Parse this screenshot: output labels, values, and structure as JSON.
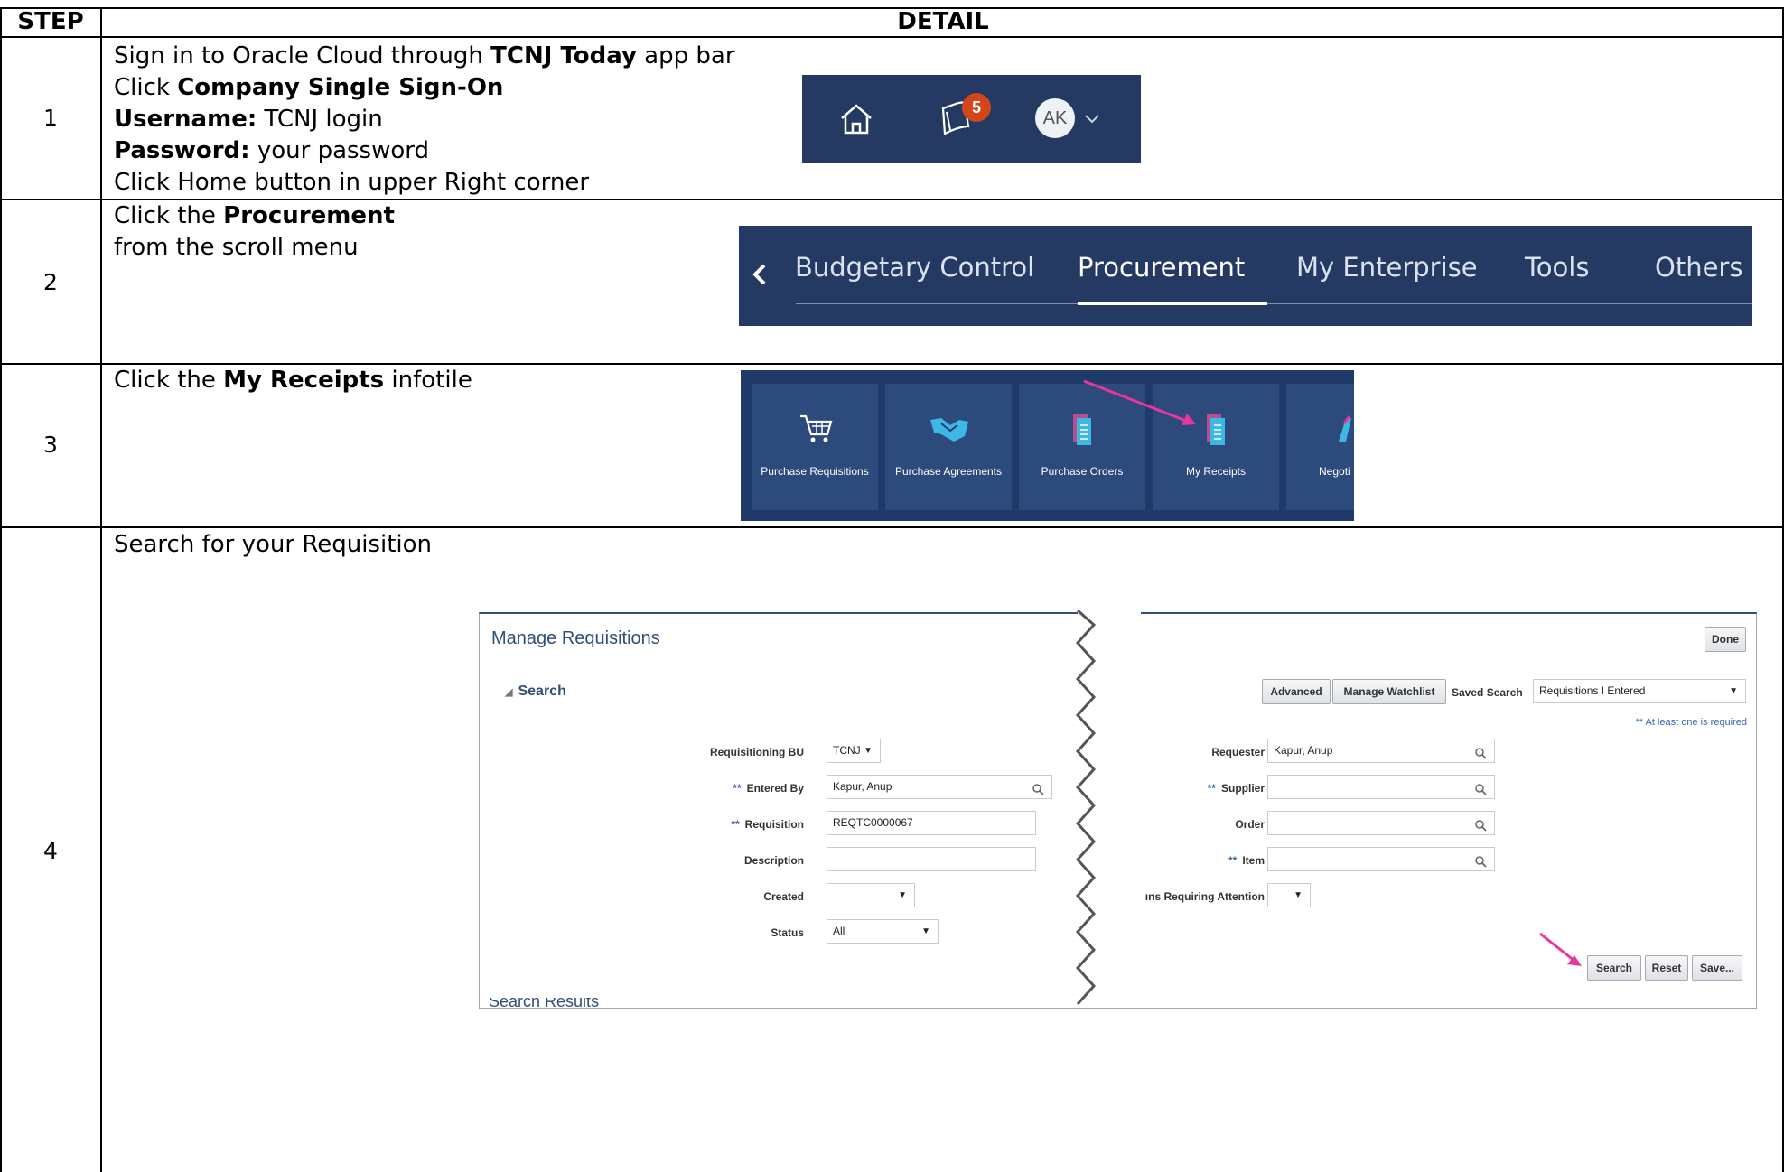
{
  "table": {
    "headers": {
      "step": "STEP",
      "detail": "DETAIL"
    },
    "rows": [
      {
        "step": "1"
      },
      {
        "step": "2"
      },
      {
        "step": "3"
      },
      {
        "step": "4"
      }
    ]
  },
  "step1": {
    "l1_a": "Sign in to Oracle Cloud through ",
    "l1_b": "TCNJ Today",
    "l1_c": " app bar",
    "l2_a": "Click ",
    "l2_b": "Company Single Sign-On",
    "l3_a": "Username:",
    "l3_b": " TCNJ login",
    "l4_a": "Password:",
    "l4_b": " your password",
    "l5": "Click Home button in upper Right corner",
    "appbar": {
      "badge": "5",
      "avatar": "AK"
    }
  },
  "step2": {
    "l1_a": "Click the ",
    "l1_b": "Procurement",
    "l2": "from the scroll menu",
    "nav": [
      "Budgetary Control",
      "Procurement",
      "My Enterprise",
      "Tools",
      "Others"
    ]
  },
  "step3": {
    "l1_a": "Click the ",
    "l1_b": "My Receipts",
    "l1_c": " infotile",
    "tiles": [
      "Purchase Requisitions",
      "Purchase Agreements",
      "Purchase Orders",
      "My Receipts",
      "Negoti"
    ]
  },
  "step4": {
    "l1": "Search for your Requisition",
    "form": {
      "title": "Manage Requisitions",
      "done": "Done",
      "search_header": "Search",
      "advanced": "Advanced",
      "manage_watchlist": "Manage Watchlist",
      "saved_search_label": "Saved Search",
      "saved_search_value": "Requisitions I Entered",
      "required_note": "** At least one is required",
      "requisitioning_bu_label": "Requisitioning BU",
      "requisitioning_bu_value": "TCNJ",
      "entered_by_label": "Entered By",
      "entered_by_value": "Kapur, Anup",
      "requisition_label": "Requisition",
      "requisition_value": "REQTC0000067",
      "description_label": "Description",
      "created_label": "Created",
      "status_label": "Status",
      "status_value": "All",
      "requester_label": "Requester",
      "requester_value": "Kapur, Anup",
      "supplier_label": "Supplier",
      "order_label": "Order",
      "item_label": "Item",
      "attention_label": "ıns Requiring Attention",
      "search_btn": "Search",
      "reset_btn": "Reset",
      "save_btn": "Save...",
      "results_cut": "Search Results"
    }
  },
  "colors": {
    "oracle_navy": "#243a63",
    "badge": "#d3451a",
    "arrow": "#e8369d",
    "link_blue": "#2f4e78"
  }
}
